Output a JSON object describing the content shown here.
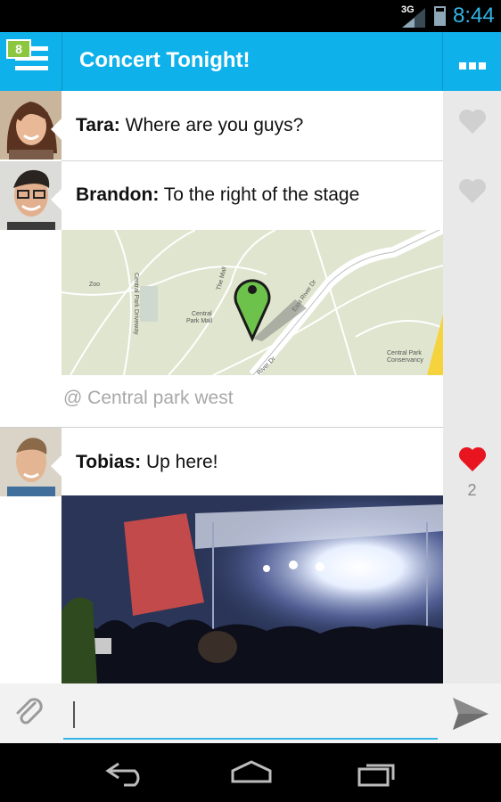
{
  "status_bar": {
    "network": "3G",
    "time": "8:44",
    "icons": [
      "signal-icon",
      "battery-icon"
    ]
  },
  "action_bar": {
    "badge_count": "8",
    "title": "Concert Tonight!",
    "icons": [
      "menu-icon",
      "overflow-icon"
    ]
  },
  "messages": [
    {
      "author": "Tara:",
      "text": "Where are you guys?",
      "liked": false
    },
    {
      "author": "Brandon:",
      "text": "To the right of the stage",
      "liked": false,
      "attachment": {
        "type": "map",
        "location": "@ Central park west",
        "map_labels": [
          "Zoo",
          "Central Park Driveway",
          "The Mall",
          "Central Park Mall",
          "East River Dr",
          "River Dr",
          "Central Park Conservancy",
          "Drive"
        ]
      }
    },
    {
      "author": "Tobias:",
      "text": "Up here!",
      "liked": true,
      "like_count": "2",
      "attachment": {
        "type": "photo",
        "subject": "concert-stage-crowd"
      }
    }
  ],
  "composer": {
    "value": "",
    "icons": [
      "paperclip-icon",
      "send-icon"
    ]
  },
  "nav_bar": {
    "icons": [
      "back-icon",
      "home-icon",
      "recents-icon"
    ]
  },
  "colors": {
    "accent": "#0fb1ea",
    "badge": "#8dc63f",
    "like": "#e8141f",
    "status_time": "#33b5e5"
  }
}
